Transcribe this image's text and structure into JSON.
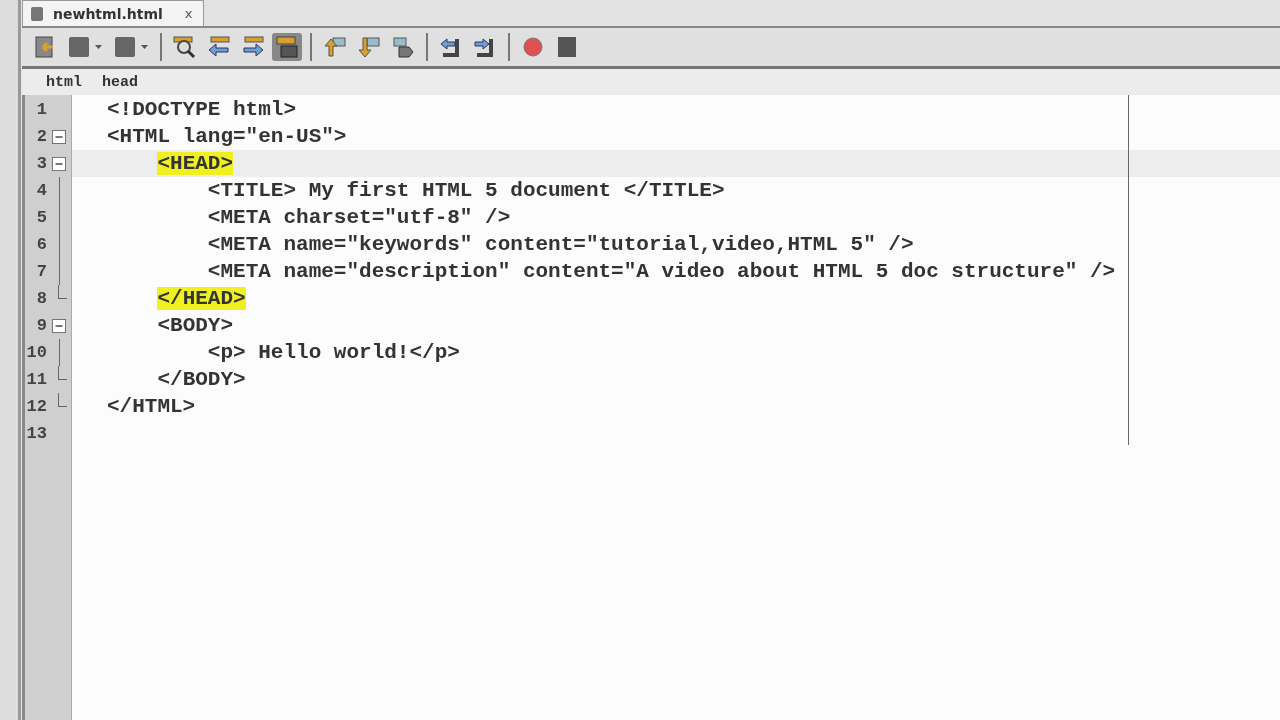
{
  "tab": {
    "title": "newhtml.html",
    "close": "x",
    "selected": true
  },
  "toolbar": [
    {
      "kind": "page"
    },
    {
      "kind": "square-menu"
    },
    {
      "kind": "square-menu"
    },
    {
      "kind": "sep"
    },
    {
      "kind": "magnifier"
    },
    {
      "kind": "left"
    },
    {
      "kind": "right"
    },
    {
      "kind": "window",
      "selected": true
    },
    {
      "kind": "sep"
    },
    {
      "kind": "up"
    },
    {
      "kind": "down"
    },
    {
      "kind": "tag"
    },
    {
      "kind": "sep"
    },
    {
      "kind": "shift-left"
    },
    {
      "kind": "shift-right"
    },
    {
      "kind": "sep"
    },
    {
      "kind": "record"
    },
    {
      "kind": "stop"
    }
  ],
  "breadcrumbs": [
    "html",
    "head"
  ],
  "lines": [
    {
      "number": "1",
      "text": "<!DOCTYPE html>",
      "kind": "plain",
      "highlighted": false,
      "current": false
    },
    {
      "number": "2",
      "text": "<HTML lang=\"en-US\">",
      "kind": "foldstart",
      "highlighted": false,
      "current": false
    },
    {
      "number": "3",
      "text": "    <HEAD>",
      "kind": "foldstart",
      "highlighted": true,
      "current": true
    },
    {
      "number": "4",
      "text": "        <TITLE> My first HTML 5 document </TITLE>",
      "kind": "inside",
      "highlighted": false,
      "current": false
    },
    {
      "number": "5",
      "text": "        <META charset=\"utf-8\" />",
      "kind": "inside",
      "highlighted": false,
      "current": false
    },
    {
      "number": "6",
      "text": "        <META name=\"keywords\" content=\"tutorial,video,HTML 5\" />",
      "kind": "inside",
      "highlighted": false,
      "current": false
    },
    {
      "number": "7",
      "text": "        <META name=\"description\" content=\"A video about HTML 5 doc structure\" />",
      "kind": "inside",
      "highlighted": false,
      "current": false
    },
    {
      "number": "8",
      "text": "    </HEAD>",
      "kind": "foldend",
      "highlighted": true,
      "current": false
    },
    {
      "number": "9",
      "text": "    <BODY>",
      "kind": "foldstart",
      "highlighted": false,
      "current": false
    },
    {
      "number": "10",
      "text": "        <p> Hello world!</p>",
      "kind": "inside",
      "highlighted": false,
      "current": false
    },
    {
      "number": "11",
      "text": "    </BODY>",
      "kind": "foldend",
      "highlighted": false,
      "current": false
    },
    {
      "number": "12",
      "text": "</HTML>",
      "kind": "foldend",
      "highlighted": false,
      "current": false
    },
    {
      "number": "13",
      "kind": "plain",
      "current": false
    }
  ]
}
